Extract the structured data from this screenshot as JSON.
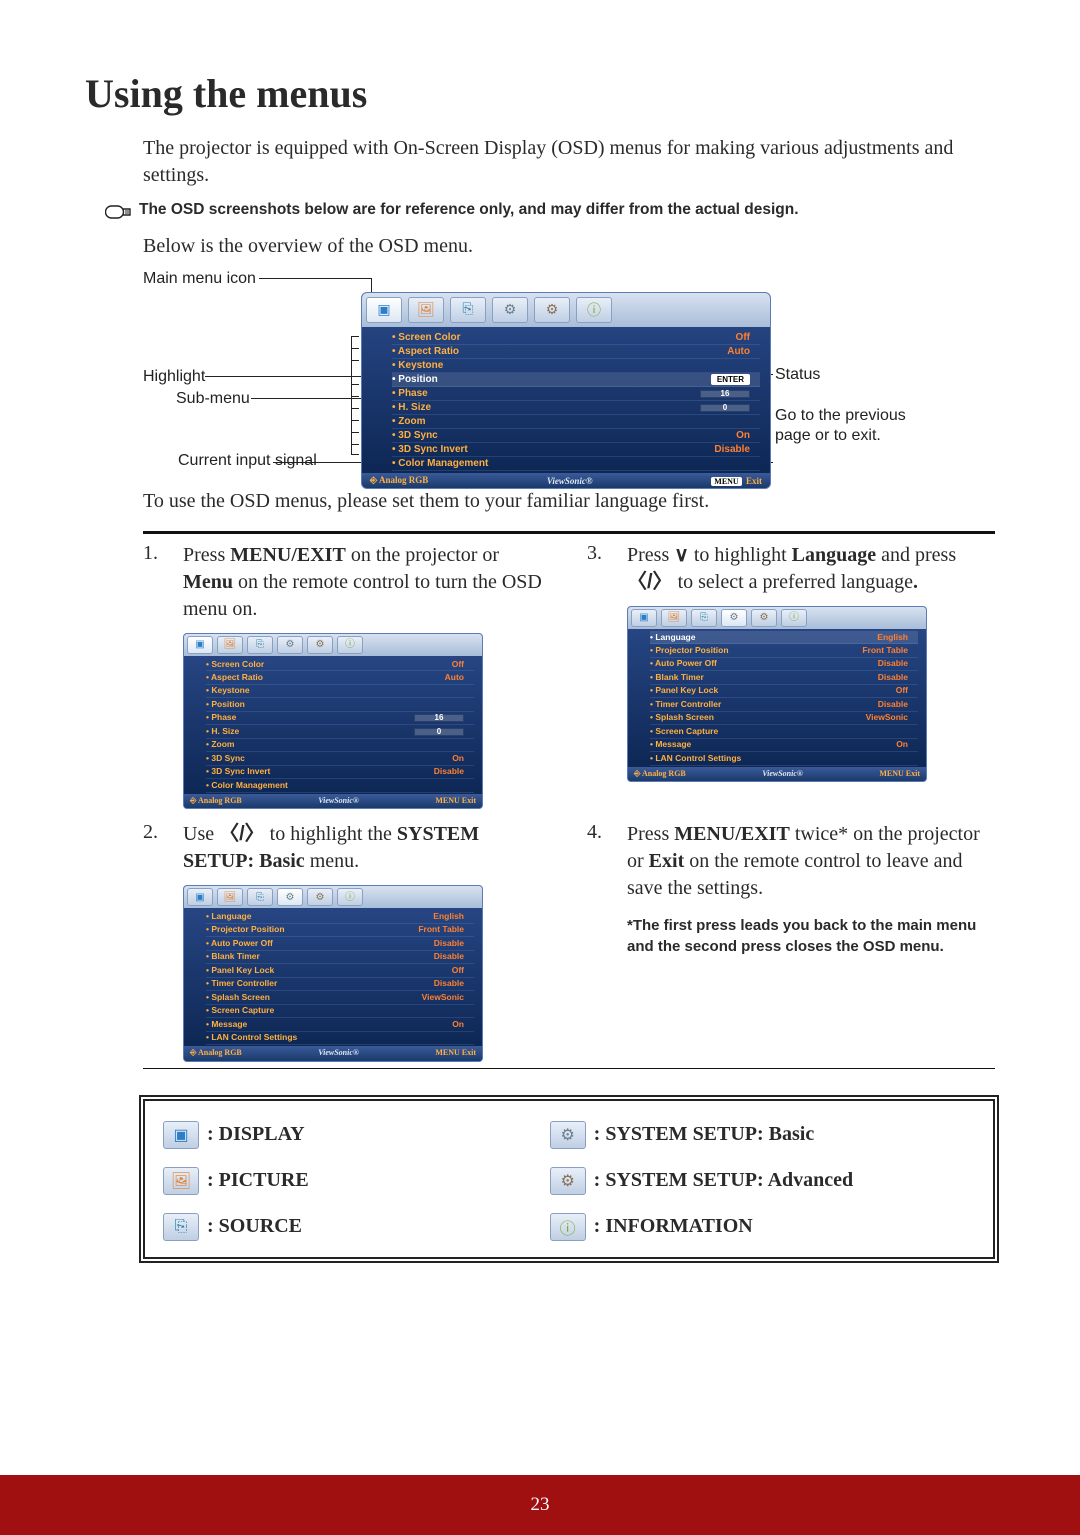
{
  "page": {
    "title": "Using the menus",
    "intro": "The projector is equipped with On-Screen Display (OSD) menus for making various adjustments and settings.",
    "note": "The OSD screenshots below are for reference only, and may differ from the actual design.",
    "overview_line": "Below is the overview of the OSD menu.",
    "post_text": "To use the OD menus, please set them to your familiar language first.",
    "post_text_fix": "To use the OSD menus, please set them to your familiar language first.",
    "page_number": "23"
  },
  "diagram_labels": {
    "main_menu": "Main menu icon",
    "highlight": "Highlight",
    "submenu": "Sub-menu",
    "current_input": "Current input signal",
    "status": "Status",
    "goto": "Go to the previous page or to exit."
  },
  "osd_big": {
    "items": [
      {
        "label": "Screen Color",
        "val": "Off",
        "type": "text"
      },
      {
        "label": "Aspect Ratio",
        "val": "Auto",
        "type": "text"
      },
      {
        "label": "Keystone",
        "val": "",
        "type": "none"
      },
      {
        "label": "Position",
        "val": "ENTER",
        "type": "enter",
        "hl": true
      },
      {
        "label": "Phase",
        "val": "16",
        "type": "bar"
      },
      {
        "label": "H. Size",
        "val": "0",
        "type": "bar"
      },
      {
        "label": "Zoom",
        "val": "",
        "type": "none"
      },
      {
        "label": "3D Sync",
        "val": "On",
        "type": "text"
      },
      {
        "label": "3D Sync Invert",
        "val": "Disable",
        "type": "text"
      },
      {
        "label": "Color Management",
        "val": "",
        "type": "none"
      }
    ],
    "footer_left": "Analog RGB",
    "footer_center": "ViewSonic",
    "footer_menu": "MENU",
    "footer_exit": "Exit"
  },
  "steps": {
    "s1": {
      "num": "1.",
      "t1": "Press ",
      "b1": "MENU/EXIT",
      "t2": " on the projector or ",
      "b2": "Menu",
      "t3": " on the remote control to turn the OSD menu on."
    },
    "s2": {
      "num": "2.",
      "t1": "Use ",
      "arrows": "〈/〉",
      "t2": " to highlight the ",
      "b1": "SYSTEM SETUP: Basic",
      "t3": " menu."
    },
    "s3": {
      "num": "3.",
      "t1": "Press ",
      "t2": " to highlight ",
      "b1": "Language",
      "t3": " and press ",
      "arrows": "〈/〉",
      "t4": " to select a preferred language",
      "b2": "."
    },
    "s4": {
      "num": "4.",
      "t1": "Press ",
      "b1": "MENU/EXIT",
      "t2": " twice* on the projector or ",
      "b2": "Exit",
      "t3": " on the remote control to leave and save the settings.",
      "note": "*The first press leads you back to the main menu and the second press closes the OSD menu."
    }
  },
  "osd_sm1": {
    "items": [
      {
        "label": "Screen Color",
        "val": "Off"
      },
      {
        "label": "Aspect Ratio",
        "val": "Auto"
      },
      {
        "label": "Keystone",
        "val": ""
      },
      {
        "label": "Position",
        "val": ""
      },
      {
        "label": "Phase",
        "val": "16",
        "type": "bar"
      },
      {
        "label": "H. Size",
        "val": "0",
        "type": "bar"
      },
      {
        "label": "Zoom",
        "val": ""
      },
      {
        "label": "3D Sync",
        "val": "On"
      },
      {
        "label": "3D Sync Invert",
        "val": "Disable"
      },
      {
        "label": "Color Management",
        "val": ""
      }
    ],
    "footer_left": "Analog RGB",
    "footer_center": "ViewSonic",
    "footer_right": "MENU Exit"
  },
  "osd_sm2": {
    "items": [
      {
        "label": "Language",
        "val": "English"
      },
      {
        "label": "Projector Position",
        "val": "Front Table"
      },
      {
        "label": "Auto Power Off",
        "val": "Disable"
      },
      {
        "label": "Blank Timer",
        "val": "Disable"
      },
      {
        "label": "Panel Key Lock",
        "val": "Off"
      },
      {
        "label": "Timer Controller",
        "val": "Disable"
      },
      {
        "label": "Splash Screen",
        "val": "ViewSonic"
      },
      {
        "label": "Screen Capture",
        "val": ""
      },
      {
        "label": "Message",
        "val": "On"
      },
      {
        "label": "LAN Control Settings",
        "val": ""
      }
    ],
    "footer_left": "Analog RGB",
    "footer_center": "ViewSonic",
    "footer_right": "MENU Exit"
  },
  "osd_sm3": {
    "hl": 0,
    "items": [
      {
        "label": "Language",
        "val": "English",
        "hl": true
      },
      {
        "label": "Projector Position",
        "val": "Front Table"
      },
      {
        "label": "Auto Power Off",
        "val": "Disable"
      },
      {
        "label": "Blank Timer",
        "val": "Disable"
      },
      {
        "label": "Panel Key Lock",
        "val": "Off"
      },
      {
        "label": "Timer Controller",
        "val": "Disable"
      },
      {
        "label": "Splash Screen",
        "val": "ViewSonic"
      },
      {
        "label": "Screen Capture",
        "val": ""
      },
      {
        "label": "Message",
        "val": "On"
      },
      {
        "label": "LAN Control Settings",
        "val": ""
      }
    ],
    "footer_left": "Analog RGB",
    "footer_center": "ViewSonic",
    "footer_right": "MENU  Exit"
  },
  "legend": {
    "items": [
      {
        "glyph": "▣",
        "color": "#2a7fc8",
        "label": "DISPLAY"
      },
      {
        "glyph": "⚙",
        "color": "#6a7f8a",
        "label": "SYSTEM SETUP: Basic"
      },
      {
        "glyph": "🖼",
        "color": "#e08030",
        "label": "PICTURE"
      },
      {
        "glyph": "⚙",
        "color": "#8a7058",
        "label": "SYSTEM SETUP: Advanced"
      },
      {
        "glyph": "⎘",
        "color": "#2a7fa8",
        "label": "SOURCE"
      },
      {
        "glyph": "ⓘ",
        "color": "#78a828",
        "label": "INFORMATION"
      }
    ]
  }
}
